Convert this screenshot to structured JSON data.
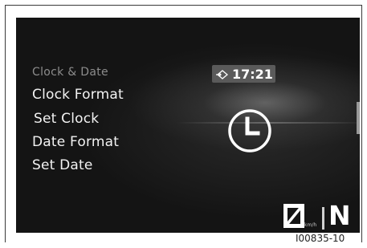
{
  "menu": {
    "title": "Clock & Date",
    "items": [
      {
        "label": "Clock Format"
      },
      {
        "label": "Set Clock"
      },
      {
        "label": "Date Format"
      },
      {
        "label": "Set Date"
      }
    ]
  },
  "status": {
    "time": "17:21",
    "time_icon": "clock-sync-icon"
  },
  "center_icon": "clock-icon",
  "speedometer": {
    "speed": "0",
    "unit": "km/h",
    "gear": "N"
  },
  "figure_ref": "I00835-10",
  "colors": {
    "screen_background": "#141414",
    "menu_title": "#8c8c8c",
    "menu_item": "#f2f2f2",
    "time_badge": "#5a5a5a"
  }
}
